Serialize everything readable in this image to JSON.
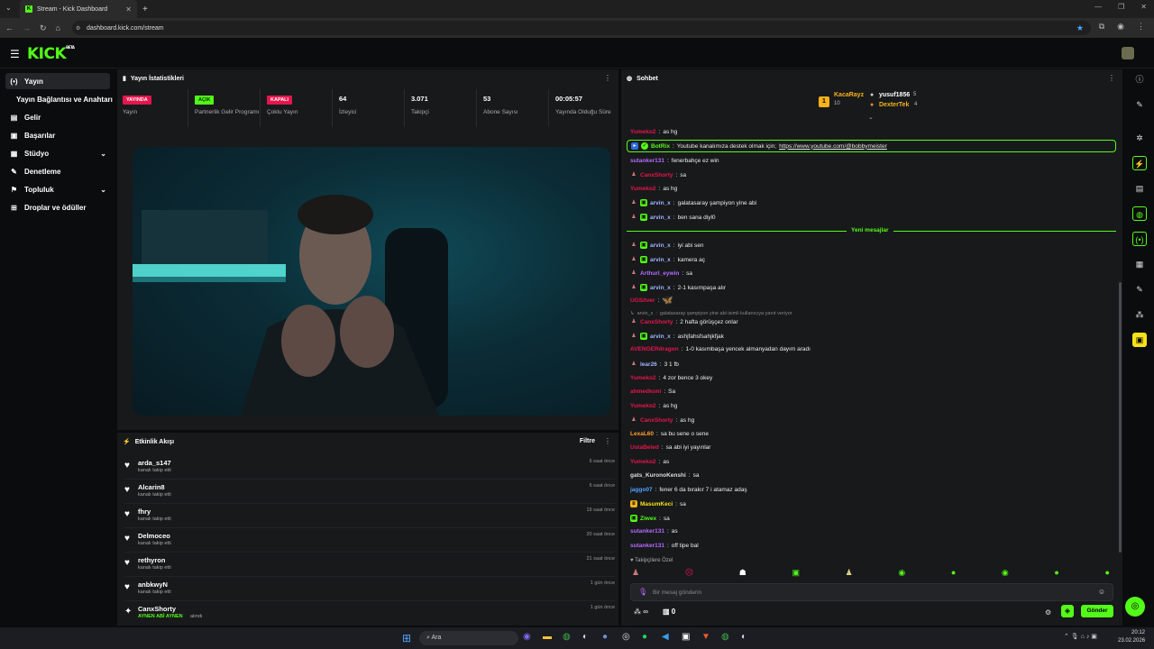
{
  "browser": {
    "tab_title": "Stream - Kick Dashboard",
    "url": "dashboard.kick.com/stream"
  },
  "app": {
    "logo": "KICK",
    "beta": "BETA"
  },
  "sidebar": {
    "items": [
      {
        "label": "Yayın",
        "icon": "broadcast-icon"
      },
      {
        "label": "Yayın Bağlantısı ve Anahtarı",
        "icon": ""
      },
      {
        "label": "Gelir",
        "icon": "wallet-icon"
      },
      {
        "label": "Başarılar",
        "icon": "trophy-icon"
      },
      {
        "label": "Stüdyo",
        "icon": "studio-icon"
      },
      {
        "label": "Denetleme",
        "icon": "wrench-icon"
      },
      {
        "label": "Topluluk",
        "icon": "community-icon"
      },
      {
        "label": "Droplar ve ödüller",
        "icon": "gift-icon"
      }
    ]
  },
  "stats": {
    "title": "Yayın İstatistikleri",
    "items": [
      {
        "badge": "YAYINDA",
        "badge_color": "#e3164d",
        "label": "Yayın"
      },
      {
        "badge": "AÇIK",
        "badge_color": "#53fc18",
        "label": "Partnerlik Gelir Programı"
      },
      {
        "badge": "KAPALI",
        "badge_color": "#e3164d",
        "label": "Çoklu Yayın"
      },
      {
        "value": "64",
        "label": "İzleyici"
      },
      {
        "value": "3.071",
        "label": "Takipçi"
      },
      {
        "value": "53",
        "label": "Abone Sayısı"
      },
      {
        "value": "00:05:57",
        "label": "Yayında Olduğu Süre"
      }
    ]
  },
  "events": {
    "title": "Etkinlik Akışı",
    "filter": "Filtre",
    "items": [
      {
        "name": "arda_s147",
        "sub": "kanalı takip etti",
        "time": "6 saat önce"
      },
      {
        "name": "Alcarin8",
        "sub": "kanalı takip etti",
        "time": "6 saat önce"
      },
      {
        "name": "fhry",
        "sub": "kanalı takip etti",
        "time": "19 saat önce"
      },
      {
        "name": "Delmoceo",
        "sub": "kanalı takip etti",
        "time": "20 saat önce"
      },
      {
        "name": "rethyron",
        "sub": "kanalı takip etti",
        "time": "21 saat önce"
      },
      {
        "name": "anbkwyN",
        "sub": "kanalı takip etti",
        "time": "1 gün önce"
      },
      {
        "name": "CanxShorty",
        "sub": "AYNEN ABİ AYNEN",
        "sub_prefix": "alındı",
        "time": "1 gün önce"
      }
    ]
  },
  "chat": {
    "title": "Sohbet",
    "top": [
      {
        "name": "KacaRayz",
        "count": "10"
      },
      {
        "name": "yusuf1856",
        "count": "5"
      },
      {
        "name": "DexterTek",
        "count": "4"
      }
    ],
    "pinned_user": "BotRix",
    "pinned_text": "Youtube kanalımıza destek olmak için;",
    "pinned_link": "https://www.youtube.com/@bobbymeister",
    "new_messages": "Yeni mesajlar",
    "messages": [
      {
        "user": "Yumeko2",
        "color": "#e3164d",
        "text": "as hg"
      },
      {
        "user": "sutanker131",
        "color": "#b36bff",
        "text": "fenerbahçe ez win"
      },
      {
        "user": "CanxShorty",
        "color": "#e3164d",
        "text": "sa"
      },
      {
        "user": "Yumeko2",
        "color": "#e3164d",
        "text": "as hg"
      },
      {
        "user": "arvin_x",
        "color": "#9fb3ff",
        "text": "galatasaray şampiyon yine abi"
      },
      {
        "user": "arvin_x",
        "color": "#9fb3ff",
        "text": "ben sana diyl0"
      },
      {
        "user": "arvin_x",
        "color": "#9fb3ff",
        "text": "iyi abi sen"
      },
      {
        "user": "arvin_x",
        "color": "#9fb3ff",
        "text": "kamera aç"
      },
      {
        "user": "Arthurl_eywin",
        "color": "#b36bff",
        "text": "sa"
      },
      {
        "user": "arvin_x",
        "color": "#9fb3ff",
        "text": "2-1 kasımpaşa alır"
      },
      {
        "user": "UGSilver",
        "color": "#e3164d",
        "text": "🦋"
      },
      {
        "user": "arvin_x",
        "color": "#888",
        "text": "galatasaray şampiyon yine abi isimli kullanıcıya yanıt veriyor"
      },
      {
        "user": "CanxShorty",
        "color": "#e3164d",
        "text": "2 hafta görüşçez onlar"
      },
      {
        "user": "arvin_x",
        "color": "#9fb3ff",
        "text": "ashjfahsfsahjkfjak"
      },
      {
        "user": "AVENGERdragon",
        "color": "#e3164d",
        "text": "1-0 kasımbaşa yencek almanyadan dayım aradı"
      },
      {
        "user": "lear26",
        "color": "#9fb3ff",
        "text": "3 1 fb"
      },
      {
        "user": "Yumeko2",
        "color": "#e3164d",
        "text": "4 zor bence 3 okey"
      },
      {
        "user": "ahmedkoni",
        "color": "#e3164d",
        "text": "Sa"
      },
      {
        "user": "Yumeko2",
        "color": "#e3164d",
        "text": "as hg"
      },
      {
        "user": "CanxShorty",
        "color": "#e3164d",
        "text": "as hg"
      },
      {
        "user": "LexaL60",
        "color": "#ff9e2c",
        "text": "sa bu sene o sene"
      },
      {
        "user": "UstaBeled",
        "color": "#e3164d",
        "text": "sa abi iyi yayınlar"
      },
      {
        "user": "Yumeko2",
        "color": "#e3164d",
        "text": "as"
      },
      {
        "user": "gats_KuronoKenshi",
        "color": "#dddddd",
        "text": "sa"
      },
      {
        "user": "jaggo07",
        "color": "#4fa3ff",
        "text": "fener 6 da bırakır 7 i atamaz adaş"
      },
      {
        "user": "MasumKeci",
        "color": "#f5e21a",
        "text": "sa"
      },
      {
        "user": "Ziwex",
        "color": "#53fc18",
        "text": "sa"
      },
      {
        "user": "sutanker131",
        "color": "#b36bff",
        "text": "as"
      },
      {
        "user": "sutanker131",
        "color": "#b36bff",
        "text": "off tipe bal"
      }
    ],
    "followers_only": "Takipçilere Özel",
    "input_placeholder": "Bir mesaj gönderin",
    "points": "∞",
    "shop_count": "0",
    "send": "Gönder"
  },
  "taskbar": {
    "search": "Ara",
    "time": "20:12",
    "date": "23.02.2026"
  },
  "colors": {
    "accent": "#53fc18",
    "live": "#e3164d",
    "panel": "#18191b",
    "bg": "#0b0c0d"
  }
}
